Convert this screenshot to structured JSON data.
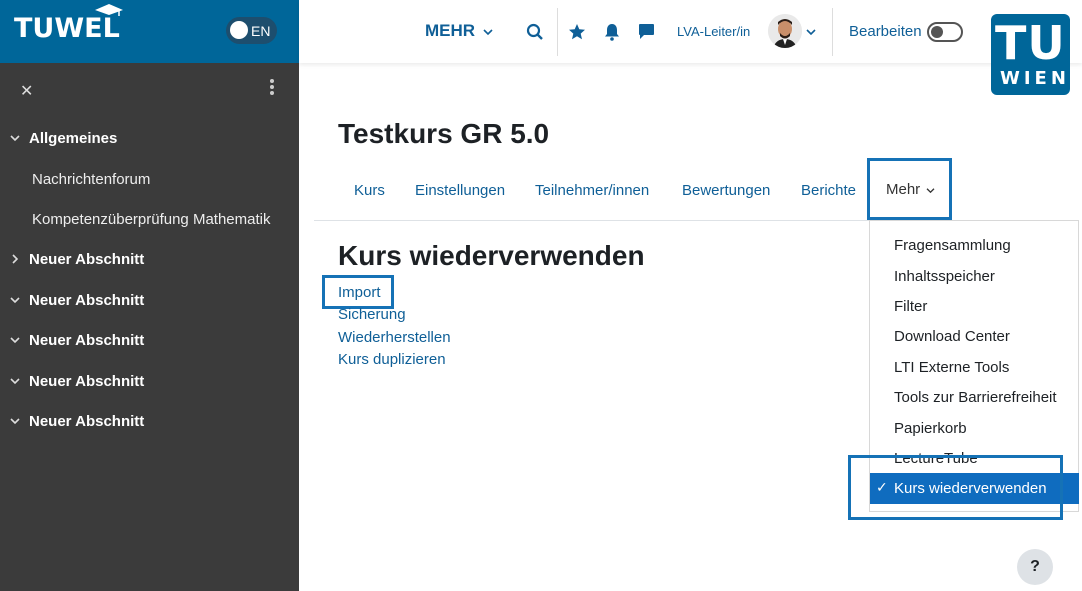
{
  "brand": {
    "logo_text": "TUWEL",
    "lang": "EN"
  },
  "sidebar": {
    "items": [
      {
        "label": "Allgemeines",
        "expanded": true
      },
      {
        "label": "Nachrichtenforum"
      },
      {
        "label": "Kompetenzüberprüfung Mathematik"
      },
      {
        "label": "Neuer Abschnitt",
        "expanded": false
      },
      {
        "label": "Neuer Abschnitt",
        "expanded": true
      },
      {
        "label": "Neuer Abschnitt",
        "expanded": true
      },
      {
        "label": "Neuer Abschnitt",
        "expanded": true
      },
      {
        "label": "Neuer Abschnitt",
        "expanded": true
      }
    ]
  },
  "topbar": {
    "more_label": "MEHR",
    "role_label": "LVA-Leiter/in",
    "edit_label": "Bearbeiten",
    "tu_logo_top": "TU",
    "tu_logo_bottom": "WIEN"
  },
  "course": {
    "title": "Testkurs GR 5.0"
  },
  "tabs": [
    "Kurs",
    "Einstellungen",
    "Teilnehmer/innen",
    "Bewertungen",
    "Berichte",
    "Mehr"
  ],
  "page": {
    "title": "Kurs wiederverwenden",
    "links": [
      "Import",
      "Sicherung",
      "Wiederherstellen",
      "Kurs duplizieren"
    ]
  },
  "dropdown": {
    "items": [
      "Fragensammlung",
      "Inhaltsspeicher",
      "Filter",
      "Download Center",
      "LTI Externe Tools",
      "Tools zur Barrierefreiheit",
      "Papierkorb",
      "LectureTube"
    ],
    "active": "Kurs wiederverwenden"
  },
  "help": {
    "label": "?"
  },
  "colors": {
    "brand": "#006699",
    "sidebar": "#3b3b3b",
    "link": "#0f5f97",
    "highlight": "#1572b6",
    "active": "#0f6cbf"
  }
}
